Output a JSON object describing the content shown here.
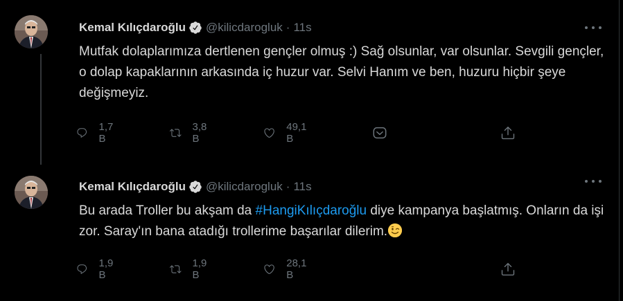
{
  "tweets": [
    {
      "name": "Kemal Kılıçdaroğlu",
      "handle": "@kilicdarogluk",
      "separator": "·",
      "time": "11s",
      "text": "Mutfak dolaplarımıza dertlenen gençler olmuş :) Sağ olsunlar, var olsunlar. Sevgili gençler, o dolap kapaklarının arkasında iç huzur var. Selvi Hanım ve ben, huzuru hiçbir şeye değişmeyiz.",
      "replies": "1,7 B",
      "retweets": "3,8 B",
      "likes": "49,1 B"
    },
    {
      "name": "Kemal Kılıçdaroğlu",
      "handle": "@kilicdarogluk",
      "separator": "·",
      "time": "11s",
      "text_before": "Bu arada Troller bu akşam da ",
      "hashtag": "#HangiKılıçdaroğlu",
      "text_after": " diye kampanya başlatmış. Onların da işi zor. Saray'ın bana atadığı trollerime başarılar dilerim.",
      "emoji": "winking-face",
      "replies": "1,9 B",
      "retweets": "1,9 B",
      "likes": "28,1 B"
    }
  ],
  "colors": {
    "background": "#000000",
    "text": "#d9d9d9",
    "secondary": "#6e767d",
    "accent": "#1d9bf0"
  }
}
